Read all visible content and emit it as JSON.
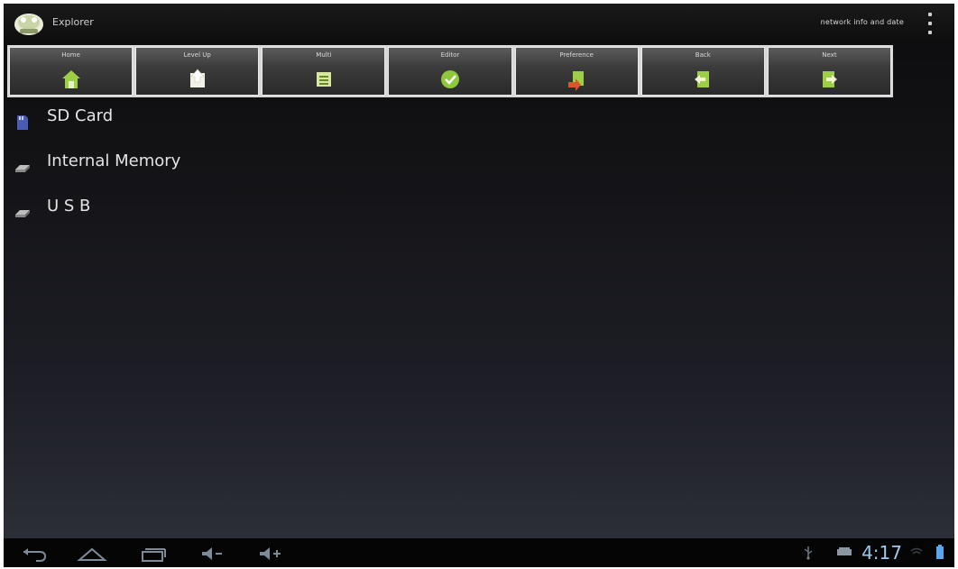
{
  "action_bar": {
    "app_title": "Explorer",
    "status_text": "network info and date"
  },
  "toolbar": {
    "buttons": [
      {
        "label": "Home",
        "icon": "home-icon"
      },
      {
        "label": "Level Up",
        "icon": "level-up-icon"
      },
      {
        "label": "Multi",
        "icon": "multi-select-icon"
      },
      {
        "label": "Editor",
        "icon": "editor-icon"
      },
      {
        "label": "Preference",
        "icon": "preference-icon"
      },
      {
        "label": "Back",
        "icon": "back-icon"
      },
      {
        "label": "Next",
        "icon": "next-icon"
      }
    ]
  },
  "file_list": {
    "items": [
      {
        "label": "SD Card",
        "icon": "sd-card-icon"
      },
      {
        "label": "Internal Memory",
        "icon": "drive-icon"
      },
      {
        "label": "U S B",
        "icon": "drive-icon"
      }
    ]
  },
  "nav_bar": {
    "clock": "4:17"
  },
  "colors": {
    "accent_clock": "#9ec9ef",
    "toolbar_green": "#8fc83a"
  }
}
